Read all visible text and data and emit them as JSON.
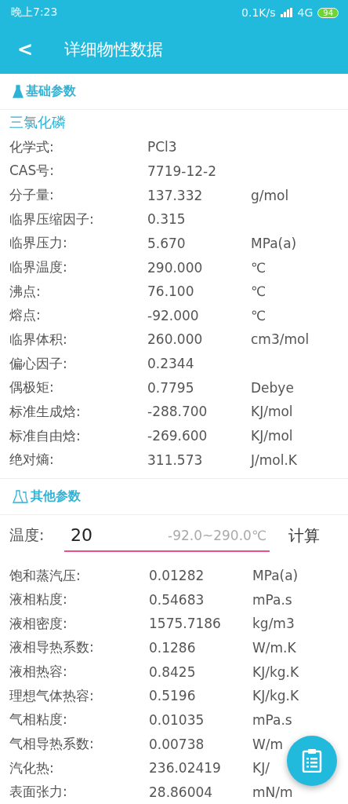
{
  "status_bar": {
    "time": "晚上7:23",
    "speed": "0.1K/s",
    "network": "4G",
    "battery": "94"
  },
  "toolbar": {
    "back": "<",
    "title": "详细物性数据"
  },
  "basic_section": {
    "title": "基础参数",
    "compound": "三氯化磷",
    "rows": [
      {
        "label": "化学式:",
        "value": "PCl3"
      },
      {
        "label": "CAS号:",
        "value": "7719-12-2"
      },
      {
        "label": "分子量:",
        "value": "137.332",
        "unit": "g/mol"
      },
      {
        "label": "临界压缩因子:",
        "value": "0.315"
      },
      {
        "label": "临界压力:",
        "value": "5.670",
        "unit": "MPa(a)"
      },
      {
        "label": "临界温度:",
        "value": "290.000",
        "unit": "℃"
      },
      {
        "label": "沸点:",
        "value": "76.100",
        "unit": "℃"
      },
      {
        "label": "熔点:",
        "value": "-92.000",
        "unit": "℃"
      },
      {
        "label": "临界体积:",
        "value": "260.000",
        "unit": "cm3/mol"
      },
      {
        "label": "偏心因子:",
        "value": "0.2344"
      },
      {
        "label": "偶极矩:",
        "value": "0.7795",
        "unit": "Debye"
      },
      {
        "label": "标准生成焓:",
        "value": "-288.700",
        "unit": "KJ/mol"
      },
      {
        "label": "标准自由焓:",
        "value": "-269.600",
        "unit": "KJ/mol"
      },
      {
        "label": "绝对熵:",
        "value": "311.573",
        "unit": "J/mol.K"
      }
    ]
  },
  "other_section": {
    "title": "其他参数",
    "temperature": {
      "label": "温度:",
      "value": "20",
      "range": "-92.0~290.0℃",
      "button": "计算"
    },
    "rows": [
      {
        "label": "饱和蒸汽压:",
        "value": "0.01282",
        "unit": "MPa(a)"
      },
      {
        "label": "液相粘度:",
        "value": "0.54683",
        "unit": "mPa.s"
      },
      {
        "label": "液相密度:",
        "value": "1575.7186",
        "unit": "kg/m3"
      },
      {
        "label": "液相导热系数:",
        "value": "0.1286",
        "unit": "W/m.K"
      },
      {
        "label": "液相热容:",
        "value": "0.8425",
        "unit": "KJ/kg.K"
      },
      {
        "label": "理想气体热容:",
        "value": "0.5196",
        "unit": "KJ/kg.K"
      },
      {
        "label": "气相粘度:",
        "value": "0.01035",
        "unit": "mPa.s"
      },
      {
        "label": "气相导热系数:",
        "value": "0.00738",
        "unit": "W/m"
      },
      {
        "label": "汽化热:",
        "value": "236.02419",
        "unit": "KJ/"
      },
      {
        "label": "表面张力:",
        "value": "28.86004",
        "unit": "mN/m"
      }
    ]
  }
}
